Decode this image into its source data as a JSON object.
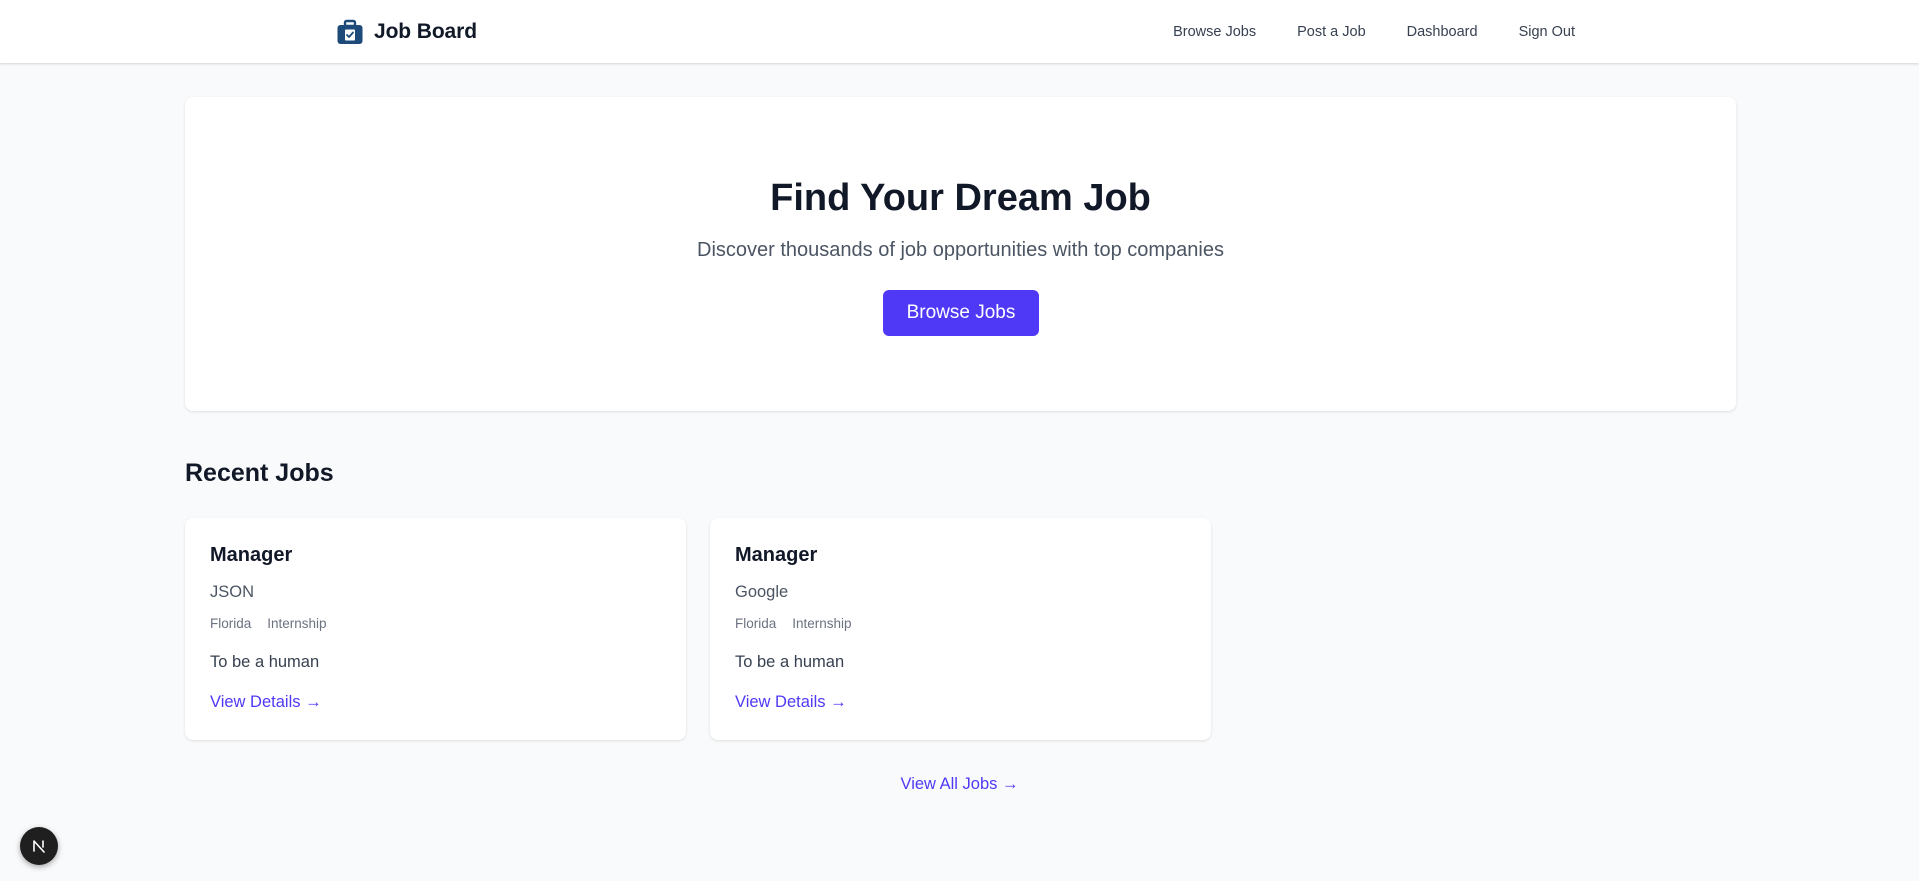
{
  "header": {
    "brand": "Job Board",
    "nav": [
      "Browse Jobs",
      "Post a Job",
      "Dashboard",
      "Sign Out"
    ]
  },
  "hero": {
    "title": "Find Your Dream Job",
    "subtitle": "Discover thousands of job opportunities with top companies",
    "button": "Browse Jobs"
  },
  "recent": {
    "title": "Recent Jobs",
    "jobs": [
      {
        "title": "Manager",
        "company": "JSON",
        "location": "Florida",
        "type": "Internship",
        "description": "To be a human",
        "link": "View Details →"
      },
      {
        "title": "Manager",
        "company": "Google",
        "location": "Florida",
        "type": "Internship",
        "description": "To be a human",
        "link": "View Details →"
      }
    ],
    "view_all": "View All Jobs →"
  },
  "icons": {
    "brand": "briefcase-icon",
    "badge": "nextjs-logo-icon"
  },
  "colors": {
    "accent": "#4f39f6",
    "brand_icon": "#1e4a7a",
    "page_bg": "#f9fafb"
  }
}
